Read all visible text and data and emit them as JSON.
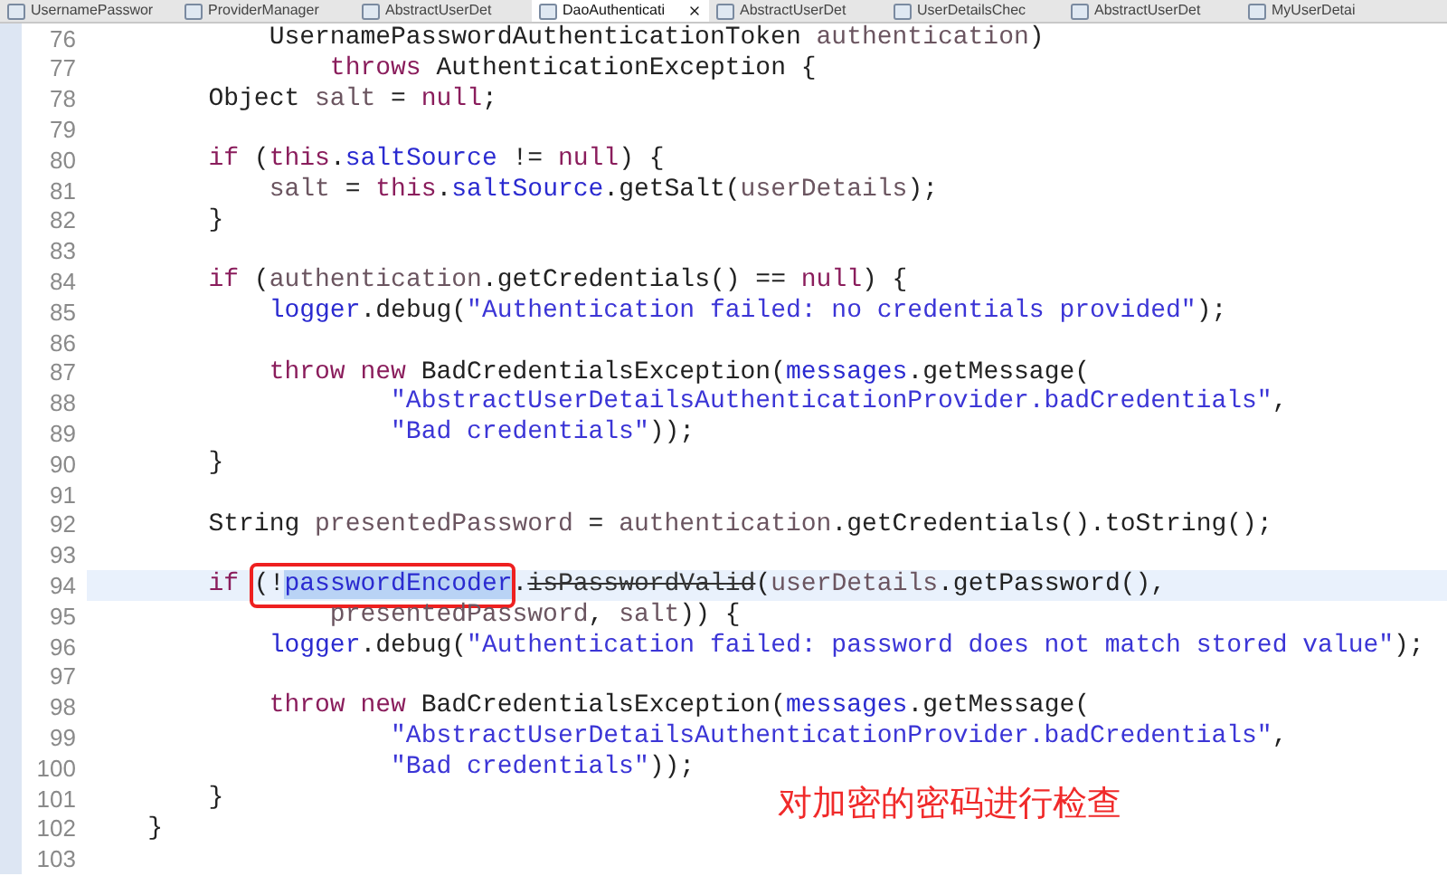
{
  "tabs": [
    {
      "label": "UsernamePasswor",
      "selected": false
    },
    {
      "label": "ProviderManager",
      "selected": false
    },
    {
      "label": "AbstractUserDet",
      "selected": false
    },
    {
      "label": "DaoAuthenticati",
      "selected": true
    },
    {
      "label": "AbstractUserDet",
      "selected": false
    },
    {
      "label": "UserDetailsChec",
      "selected": false
    },
    {
      "label": "AbstractUserDet",
      "selected": false
    },
    {
      "label": "MyUserDetai",
      "selected": false
    }
  ],
  "editor": {
    "lines": [
      {
        "number": "76",
        "current": false,
        "segments": [
          {
            "kind": "plain",
            "text": "            UsernamePasswordAuthenticationToken "
          },
          {
            "kind": "variable",
            "text": "authentication"
          },
          {
            "kind": "plain",
            "text": ")"
          }
        ]
      },
      {
        "number": "77",
        "current": false,
        "segments": [
          {
            "kind": "keyword",
            "text": "                throws"
          },
          {
            "kind": "plain",
            "text": " AuthenticationException {"
          }
        ]
      },
      {
        "number": "78",
        "current": false,
        "segments": [
          {
            "kind": "plain",
            "text": "        Object "
          },
          {
            "kind": "variable",
            "text": "salt"
          },
          {
            "kind": "plain",
            "text": " = "
          },
          {
            "kind": "keyword",
            "text": "null"
          },
          {
            "kind": "plain",
            "text": ";"
          }
        ]
      },
      {
        "number": "79",
        "current": false
      },
      {
        "number": "80",
        "current": false,
        "segments": [
          {
            "kind": "keyword",
            "text": "        if"
          },
          {
            "kind": "plain",
            "text": " ("
          },
          {
            "kind": "keyword",
            "text": "this"
          },
          {
            "kind": "plain",
            "text": "."
          },
          {
            "kind": "field",
            "text": "saltSource"
          },
          {
            "kind": "plain",
            "text": " != "
          },
          {
            "kind": "keyword",
            "text": "null"
          },
          {
            "kind": "plain",
            "text": ") {"
          }
        ]
      },
      {
        "number": "81",
        "current": false,
        "segments": [
          {
            "kind": "variable",
            "text": "            salt"
          },
          {
            "kind": "plain",
            "text": " = "
          },
          {
            "kind": "keyword",
            "text": "this"
          },
          {
            "kind": "plain",
            "text": "."
          },
          {
            "kind": "field",
            "text": "saltSource"
          },
          {
            "kind": "plain",
            "text": ".getSalt("
          },
          {
            "kind": "variable",
            "text": "userDetails"
          },
          {
            "kind": "plain",
            "text": ");"
          }
        ]
      },
      {
        "number": "82",
        "current": false,
        "segments": [
          {
            "kind": "plain",
            "text": "        }"
          }
        ]
      },
      {
        "number": "83",
        "current": false
      },
      {
        "number": "84",
        "current": false,
        "segments": [
          {
            "kind": "keyword",
            "text": "        if"
          },
          {
            "kind": "plain",
            "text": " ("
          },
          {
            "kind": "variable",
            "text": "authentication"
          },
          {
            "kind": "plain",
            "text": ".getCredentials() == "
          },
          {
            "kind": "keyword",
            "text": "null"
          },
          {
            "kind": "plain",
            "text": ") {"
          }
        ]
      },
      {
        "number": "85",
        "current": false,
        "segments": [
          {
            "kind": "field",
            "text": "            logger"
          },
          {
            "kind": "plain",
            "text": ".debug("
          },
          {
            "kind": "string",
            "text": "\"Authentication failed: no credentials provided\""
          },
          {
            "kind": "plain",
            "text": ");"
          }
        ]
      },
      {
        "number": "86",
        "current": false
      },
      {
        "number": "87",
        "current": false,
        "segments": [
          {
            "kind": "keyword",
            "text": "            throw new"
          },
          {
            "kind": "plain",
            "text": " BadCredentialsException("
          },
          {
            "kind": "field",
            "text": "messages"
          },
          {
            "kind": "plain",
            "text": ".getMessage("
          }
        ]
      },
      {
        "number": "88",
        "current": false,
        "segments": [
          {
            "kind": "string",
            "text": "                    \"AbstractUserDetailsAuthenticationProvider.badCredentials\""
          },
          {
            "kind": "plain",
            "text": ","
          }
        ]
      },
      {
        "number": "89",
        "current": false,
        "segments": [
          {
            "kind": "string",
            "text": "                    \"Bad credentials\""
          },
          {
            "kind": "plain",
            "text": "));"
          }
        ]
      },
      {
        "number": "90",
        "current": false,
        "segments": [
          {
            "kind": "plain",
            "text": "        }"
          }
        ]
      },
      {
        "number": "91",
        "current": false
      },
      {
        "number": "92",
        "current": false,
        "segments": [
          {
            "kind": "plain",
            "text": "        String "
          },
          {
            "kind": "variable",
            "text": "presentedPassword"
          },
          {
            "kind": "plain",
            "text": " = "
          },
          {
            "kind": "variable",
            "text": "authentication"
          },
          {
            "kind": "plain",
            "text": ".getCredentials().toString();"
          }
        ]
      },
      {
        "number": "93",
        "current": false
      },
      {
        "number": "94",
        "current": true,
        "segments": [
          {
            "kind": "keyword",
            "text": "        if "
          },
          {
            "kind": "plain",
            "text": "(!",
            "boxed": true
          },
          {
            "kind": "field",
            "text": "passwordEncoder",
            "selected": true,
            "boxed": true
          },
          {
            "kind": "plain",
            "text": "."
          },
          {
            "kind": "deprecated",
            "text": "isPasswordValid"
          },
          {
            "kind": "plain",
            "text": "("
          },
          {
            "kind": "variable",
            "text": "userDetails"
          },
          {
            "kind": "plain",
            "text": ".getPassword(),"
          }
        ]
      },
      {
        "number": "95",
        "current": false,
        "segments": [
          {
            "kind": "variable",
            "text": "                presentedPassword"
          },
          {
            "kind": "plain",
            "text": ", "
          },
          {
            "kind": "variable",
            "text": "salt"
          },
          {
            "kind": "plain",
            "text": ")) {"
          }
        ]
      },
      {
        "number": "96",
        "current": false,
        "segments": [
          {
            "kind": "field",
            "text": "            logger"
          },
          {
            "kind": "plain",
            "text": ".debug("
          },
          {
            "kind": "string",
            "text": "\"Authentication failed: password does not match stored value\""
          },
          {
            "kind": "plain",
            "text": ");"
          }
        ]
      },
      {
        "number": "97",
        "current": false
      },
      {
        "number": "98",
        "current": false,
        "segments": [
          {
            "kind": "keyword",
            "text": "            throw new"
          },
          {
            "kind": "plain",
            "text": " BadCredentialsException("
          },
          {
            "kind": "field",
            "text": "messages"
          },
          {
            "kind": "plain",
            "text": ".getMessage("
          }
        ]
      },
      {
        "number": "99",
        "current": false,
        "segments": [
          {
            "kind": "string",
            "text": "                    \"AbstractUserDetailsAuthenticationProvider.badCredentials\""
          },
          {
            "kind": "plain",
            "text": ","
          }
        ]
      },
      {
        "number": "100",
        "current": false,
        "segments": [
          {
            "kind": "string",
            "text": "                    \"Bad credentials\""
          },
          {
            "kind": "plain",
            "text": "));"
          }
        ]
      },
      {
        "number": "101",
        "current": false,
        "segments": [
          {
            "kind": "plain",
            "text": "        }"
          }
        ]
      },
      {
        "number": "102",
        "current": false,
        "segments": [
          {
            "kind": "plain",
            "text": "    }"
          }
        ]
      },
      {
        "number": "103",
        "current": false
      }
    ]
  },
  "annotation": {
    "caption": "对加密的密码进行检查"
  }
}
